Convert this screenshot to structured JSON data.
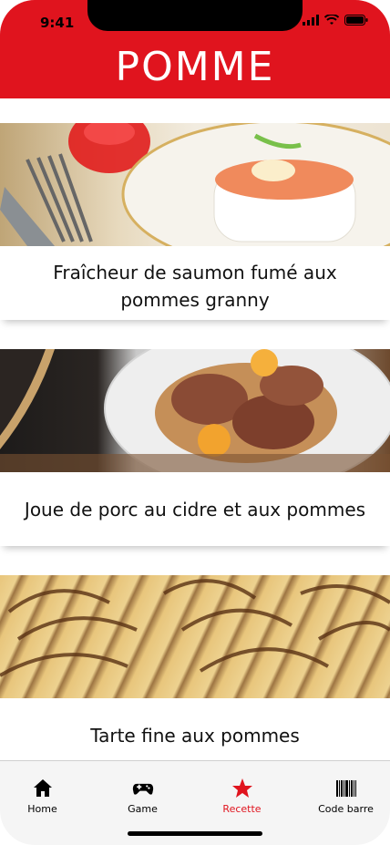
{
  "status": {
    "time": "9:41"
  },
  "header": {
    "title": "POMME"
  },
  "recipes": [
    {
      "title": "Fraîcheur de saumon fumé aux pommes granny"
    },
    {
      "title": "Joue de porc au cidre et aux pommes"
    },
    {
      "title": "Tarte fine aux pommes"
    }
  ],
  "tabs": [
    {
      "label": "Home",
      "icon": "home-icon"
    },
    {
      "label": "Game",
      "icon": "gamepad-icon"
    },
    {
      "label": "Recette",
      "icon": "star-icon"
    },
    {
      "label": "Code barre",
      "icon": "barcode-icon"
    }
  ],
  "colors": {
    "brand": "#e0141e",
    "active_tab": "#e0141e"
  }
}
